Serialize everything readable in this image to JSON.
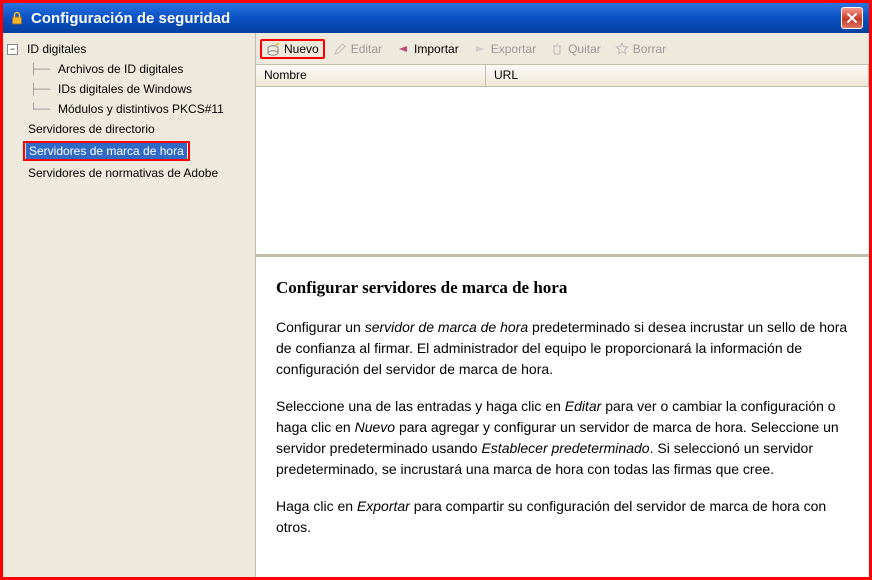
{
  "window": {
    "title": "Configuración de seguridad"
  },
  "sidebar": {
    "items": [
      {
        "label": "ID digitales",
        "level": 0,
        "expandable": true,
        "expanded": true
      },
      {
        "label": "Archivos de ID digitales",
        "level": 1
      },
      {
        "label": "IDs digitales de Windows",
        "level": 1
      },
      {
        "label": "Módulos y distintivos PKCS#11",
        "level": 1
      },
      {
        "label": "Servidores de directorio",
        "level": 0
      },
      {
        "label": "Servidores de marca de hora",
        "level": 0,
        "selected": true,
        "highlight": true
      },
      {
        "label": "Servidores de normativas de Adobe",
        "level": 0
      }
    ]
  },
  "toolbar": {
    "nuevo": "Nuevo",
    "editar": "Editar",
    "importar": "Importar",
    "exportar": "Exportar",
    "quitar": "Quitar",
    "borrar": "Borrar"
  },
  "columns": {
    "nombre": "Nombre",
    "url": "URL"
  },
  "content": {
    "heading": "Configurar servidores de marca de hora",
    "p1a": "Configurar un ",
    "p1_em1": "servidor de marca de hora",
    "p1b": " predeterminado si desea incrustar un sello de hora de confianza al firmar. El administrador del equipo le proporcionará la información de configuración del servidor de marca de hora.",
    "p2a": "Seleccione una de las entradas y haga clic en ",
    "p2_em1": "Editar",
    "p2b": " para ver o cambiar la configuración o haga clic en ",
    "p2_em2": "Nuevo",
    "p2c": " para agregar y configurar un servidor de marca de hora. Seleccione un servidor predeterminado usando ",
    "p2_em3": "Establecer predeterminado",
    "p2d": ". Si seleccionó un servidor predeterminado, se incrustará una marca de hora con todas las firmas que cree.",
    "p3a": "Haga clic en ",
    "p3_em1": "Exportar",
    "p3b": " para compartir su configuración del servidor de marca de hora con otros."
  }
}
